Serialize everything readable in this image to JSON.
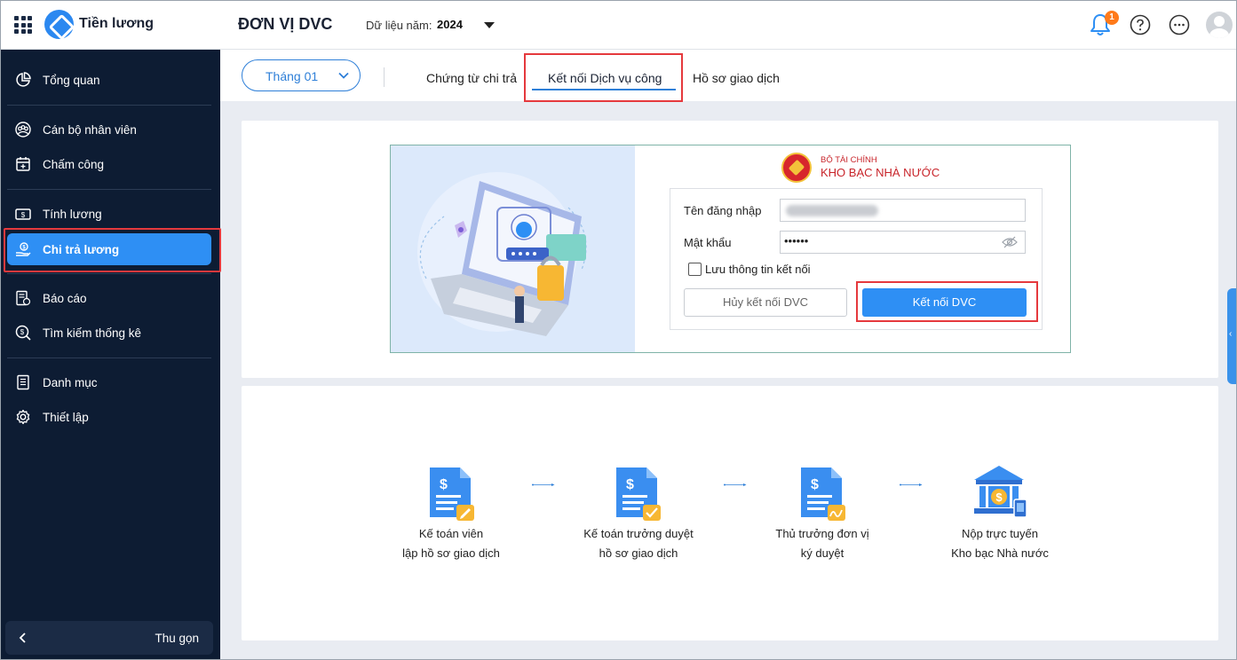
{
  "app": {
    "name": "Tiền lương"
  },
  "header": {
    "unit_name": "ĐƠN VỊ DVC",
    "year_label": "Dữ liệu năm:",
    "year_value": "2024",
    "notification_count": "1"
  },
  "sidebar": {
    "items": [
      {
        "label": "Tổng quan",
        "icon": "pie-chart-icon"
      },
      {
        "label": "Cán bộ nhân viên",
        "icon": "staff-group-icon"
      },
      {
        "label": "Chấm công",
        "icon": "calendar-icon"
      },
      {
        "label": "Tính lương",
        "icon": "salary-card-icon"
      },
      {
        "label": "Chi trả lương",
        "icon": "hand-coin-icon"
      },
      {
        "label": "Báo cáo",
        "icon": "report-icon"
      },
      {
        "label": "Tìm kiếm thống kê",
        "icon": "search-dollar-icon"
      },
      {
        "label": "Danh mục",
        "icon": "list-book-icon"
      },
      {
        "label": "Thiết lập",
        "icon": "gear-icon"
      }
    ],
    "active_item": "Chi trả lương",
    "collapse_label": "Thu gọn"
  },
  "toolbar": {
    "month": "Tháng 01",
    "tabs": [
      {
        "label": "Chứng từ chi trả"
      },
      {
        "label": "Kết nối Dịch vụ công"
      },
      {
        "label": "Hồ sơ giao dịch"
      }
    ],
    "active_tab": "Kết nối Dịch vụ công"
  },
  "login": {
    "org_line1": "BỘ TÀI CHÍNH",
    "org_line2": "KHO BẠC NHÀ NƯỚC",
    "username_label": "Tên đăng nhập",
    "password_label": "Mật khẩu",
    "password_mask": "••••••",
    "remember_label": "Lưu thông tin kết nối",
    "cancel_button": "Hủy kết nối DVC",
    "connect_button": "Kết nối DVC"
  },
  "flow": {
    "steps": [
      {
        "line1": "Kế toán viên",
        "line2": "lập hồ sơ giao dịch"
      },
      {
        "line1": "Kế toán trưởng duyệt",
        "line2": "hồ sơ giao dịch"
      },
      {
        "line1": "Thủ trưởng đơn vị",
        "line2": "ký duyệt"
      },
      {
        "line1": "Nộp trực tuyến",
        "line2": "Kho bạc Nhà nước"
      }
    ]
  },
  "colors": {
    "primary": "#2e8ff4",
    "sidebar_bg": "#0d1c33",
    "highlight": "#e5393d",
    "treasury_red": "#c8242a"
  }
}
